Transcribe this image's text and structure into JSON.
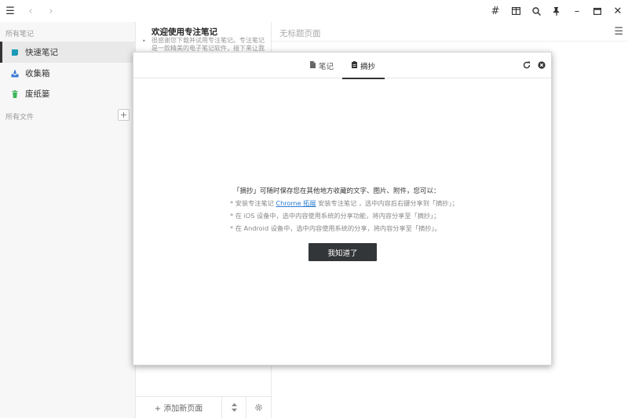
{
  "sidebar": {
    "section_notes": "所有笔记",
    "items": [
      {
        "label": "快速笔记",
        "icon": "quick-note-icon",
        "color": "#1a9bb6"
      },
      {
        "label": "收集箱",
        "icon": "inbox-icon",
        "color": "#3a7bd5"
      },
      {
        "label": "废纸篓",
        "icon": "trash-icon",
        "color": "#3cb55a"
      }
    ],
    "section_files": "所有文件",
    "add_label": "+"
  },
  "notelist": {
    "note_title": "欢迎使用专注笔记",
    "note_preview": "很感谢您下载并试用专注笔记。专注笔记是一款精美的电子笔记软件，接下来让我们简单",
    "footer_add": "+ 添加新页面"
  },
  "editor": {
    "title": "无标题页面"
  },
  "modal": {
    "tabs": [
      {
        "label": "笔记",
        "icon": "note-file-icon"
      },
      {
        "label": "摘抄",
        "icon": "clipboard-icon",
        "active": true
      }
    ],
    "intro": "「摘抄」可随时保存您在其他地方收藏的文字、图片、附件，您可以：",
    "bullet1_pre": "* 安装专注笔记 ",
    "bullet1_link": "Chrome 拓展",
    "bullet1_post": " 安装专注笔记 ，选中内容后右键分享到「摘抄」；",
    "bullet2": "* 在 iOS 设备中，选中内容使用系统的分享功能，将内容分享至「摘抄」；",
    "bullet3": "* 在 Android 设备中，选中内容使用系统的分享，将内容分享至「摘抄」。",
    "ok_button": "我知道了"
  }
}
